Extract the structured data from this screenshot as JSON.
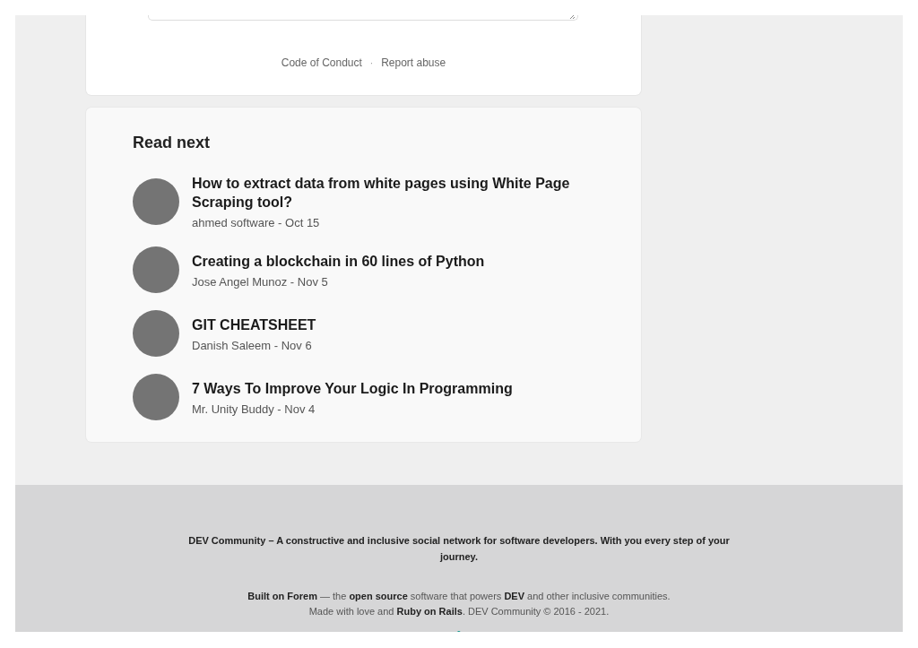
{
  "comment_box": {
    "links": [
      "Code of Conduct",
      "Report abuse"
    ],
    "separator": "·"
  },
  "read_next": {
    "heading": "Read next",
    "articles": [
      {
        "title": "How to extract data from white pages using White Page Scraping tool?",
        "meta": "ahmed software - Oct 15"
      },
      {
        "title": "Creating a blockchain in 60 lines of Python",
        "meta": "Jose Angel Munoz - Nov 5"
      },
      {
        "title": "GIT CHEATSHEET",
        "meta": "Danish Saleem - Nov 6"
      },
      {
        "title": "7 Ways To Improve Your Logic In Programming",
        "meta": "Mr. Unity Buddy - Nov 4"
      }
    ]
  },
  "footer": {
    "tagline": "DEV Community – A constructive and inclusive social network for software developers. With you every step of your journey.",
    "lines": [
      "**Built on Forem** — the **open source** software that powers **DEV** and other inclusive communities.",
      "Made with love and **Ruby on Rails**. DEV Community © 2016 - 2021."
    ]
  }
}
